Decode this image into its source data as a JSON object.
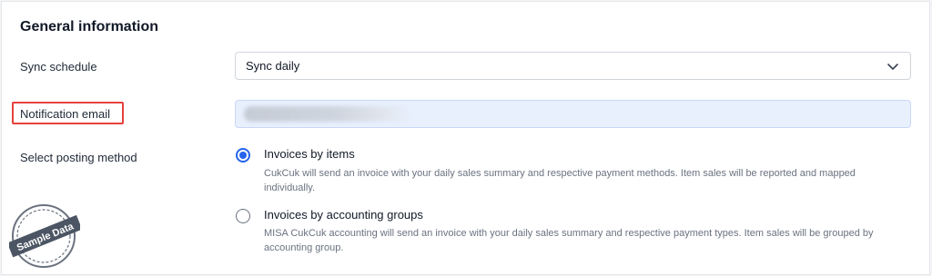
{
  "section": {
    "title": "General information"
  },
  "sync": {
    "label": "Sync schedule",
    "value": "Sync daily",
    "chevron_icon": "chevron-down-icon"
  },
  "notification": {
    "label": "Notification email",
    "highlight_color": "#e5413c",
    "value": ""
  },
  "posting": {
    "label": "Select posting method",
    "options": [
      {
        "title": "Invoices by items",
        "description": "CukCuk will send an invoice with your daily sales summary and respective payment methods. Item sales will be reported and mapped individually.",
        "selected": true
      },
      {
        "title": "Invoices by accounting groups",
        "description": "MISA CukCuk accounting will send an invoice with your daily sales summary and respective payment types. Item sales will be grouped by accounting group.",
        "selected": false
      }
    ]
  },
  "watermark": {
    "text": "Sample Data"
  },
  "colors": {
    "accent": "#2563eb",
    "input_fill": "#e8f0fe",
    "border": "#d1d5db"
  }
}
